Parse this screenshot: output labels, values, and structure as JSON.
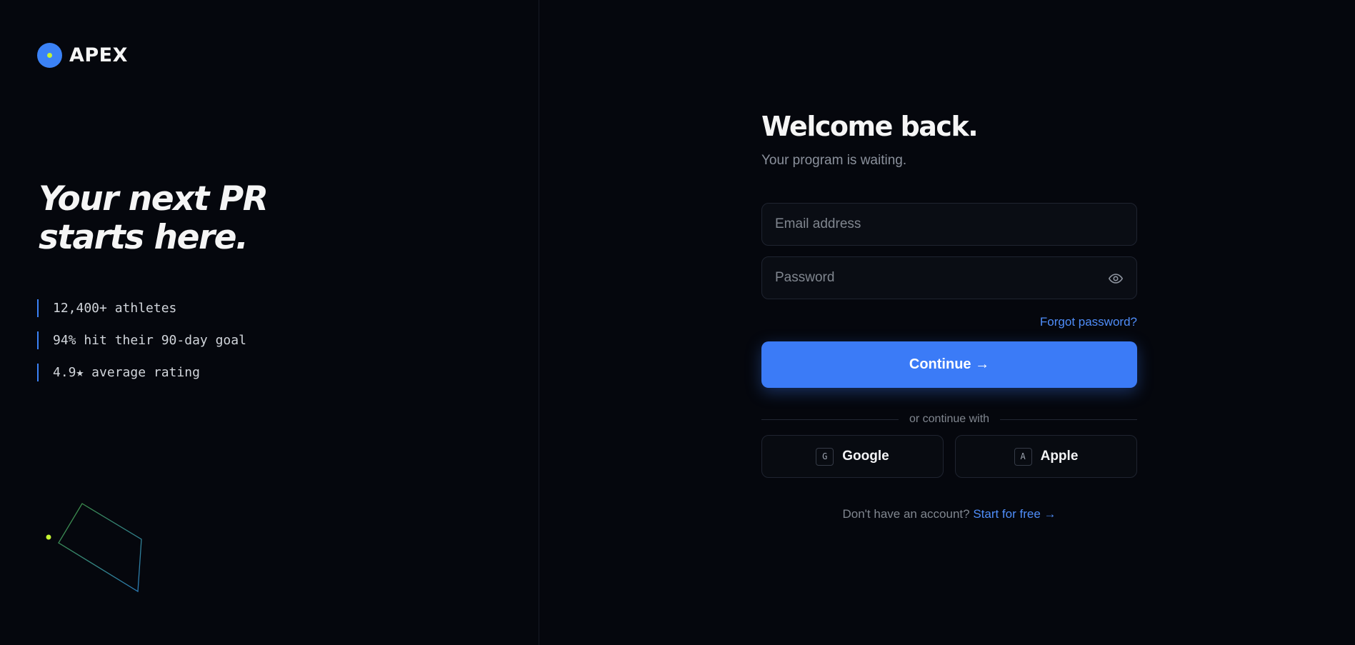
{
  "brand": {
    "name": "APEX",
    "icon": "apex-logo-icon"
  },
  "hero": {
    "line1": "Your next PR",
    "line2": "starts here."
  },
  "stats": [
    {
      "label": "12,400+ athletes"
    },
    {
      "label": "94% hit their 90-day goal"
    },
    {
      "label": "4.9★ average rating"
    }
  ],
  "form": {
    "title": "Welcome back.",
    "subtitle": "Your program is waiting.",
    "email_placeholder": "Email address",
    "password_placeholder": "Password",
    "password_toggle_icon": "eye-icon",
    "forgot": "Forgot password?",
    "continue": "Continue →",
    "divider": "or continue with",
    "google": {
      "badge": "G",
      "label": "Google"
    },
    "apple": {
      "badge": "A",
      "label": "Apple"
    },
    "signup_prompt": "Don't have an account?",
    "signup_link": "Start for free →"
  },
  "colors": {
    "background": "#05070d",
    "accent": "#3b7bf7",
    "link": "#4f8df9",
    "highlight": "#c6f432"
  }
}
